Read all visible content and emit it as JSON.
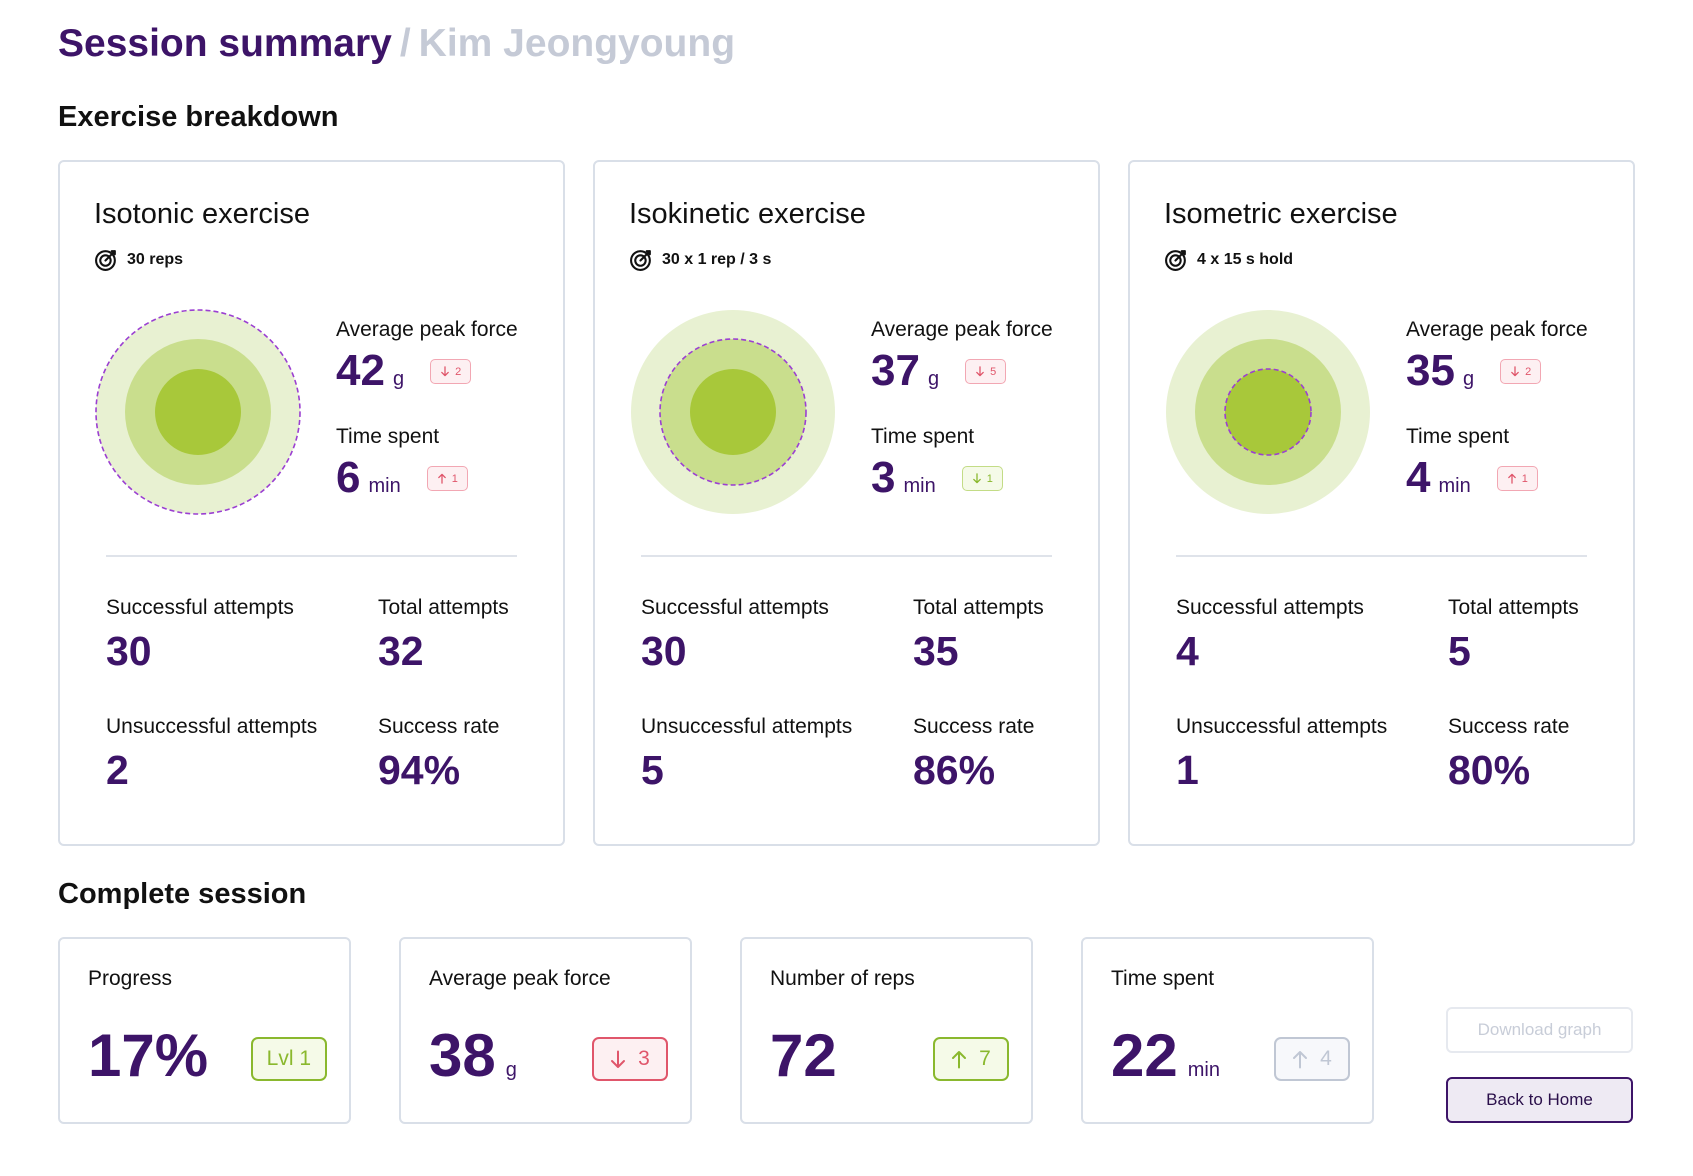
{
  "header": {
    "title": "Session summary",
    "separator": "/",
    "patient": "Kim Jeongyoung"
  },
  "sections": {
    "breakdown": "Exercise breakdown",
    "complete": "Complete session"
  },
  "colors": {
    "primary": "#3d1468",
    "ring_outer": "#e8f1d2",
    "ring_middle": "#c9de8d",
    "ring_inner": "#a8c83a",
    "target_dash": "#9b3fd2",
    "down": "#e0566b",
    "up_green": "#8ab82e",
    "muted": "#c0c7d4"
  },
  "exercises": [
    {
      "title": "Isotonic exercise",
      "target_icon": "target-icon",
      "target": "30 reps",
      "rings": {
        "target_level": "outer"
      },
      "force_label": "Average peak force",
      "force_value": "42",
      "force_unit": "g",
      "force_delta": {
        "direction": "down",
        "value": "2",
        "tone": "red"
      },
      "time_label": "Time spent",
      "time_value": "6",
      "time_unit": "min",
      "time_delta": {
        "direction": "up",
        "value": "1",
        "tone": "red"
      },
      "successful_label": "Successful attempts",
      "successful": "30",
      "total_label": "Total attempts",
      "total": "32",
      "unsuccessful_label": "Unsuccessful attempts",
      "unsuccessful": "2",
      "rate_label": "Success rate",
      "rate": "94%"
    },
    {
      "title": "Isokinetic exercise",
      "target_icon": "target-icon",
      "target": "30 x 1 rep / 3 s",
      "rings": {
        "target_level": "middle"
      },
      "force_label": "Average peak force",
      "force_value": "37",
      "force_unit": "g",
      "force_delta": {
        "direction": "down",
        "value": "5",
        "tone": "red"
      },
      "time_label": "Time spent",
      "time_value": "3",
      "time_unit": "min",
      "time_delta": {
        "direction": "down",
        "value": "1",
        "tone": "green"
      },
      "successful_label": "Successful attempts",
      "successful": "30",
      "total_label": "Total attempts",
      "total": "35",
      "unsuccessful_label": "Unsuccessful attempts",
      "unsuccessful": "5",
      "rate_label": "Success rate",
      "rate": "86%"
    },
    {
      "title": "Isometric exercise",
      "target_icon": "target-icon",
      "target": "4 x 15 s hold",
      "rings": {
        "target_level": "inner"
      },
      "force_label": "Average peak force",
      "force_value": "35",
      "force_unit": "g",
      "force_delta": {
        "direction": "down",
        "value": "2",
        "tone": "red"
      },
      "time_label": "Time spent",
      "time_value": "4",
      "time_unit": "min",
      "time_delta": {
        "direction": "up",
        "value": "1",
        "tone": "red"
      },
      "successful_label": "Successful attempts",
      "successful": "4",
      "total_label": "Total attempts",
      "total": "5",
      "unsuccessful_label": "Unsuccessful attempts",
      "unsuccessful": "1",
      "rate_label": "Success rate",
      "rate": "80%"
    }
  ],
  "summary": [
    {
      "label": "Progress",
      "value": "17%",
      "unit": "",
      "badge": {
        "text": "Lvl 1",
        "direction": "none",
        "tone": "green"
      }
    },
    {
      "label": "Average peak force",
      "value": "38",
      "unit": "g",
      "badge": {
        "text": "3",
        "direction": "down",
        "tone": "red"
      }
    },
    {
      "label": "Number of reps",
      "value": "72",
      "unit": "",
      "badge": {
        "text": "7",
        "direction": "up",
        "tone": "green"
      }
    },
    {
      "label": "Time spent",
      "value": "22",
      "unit": "min",
      "badge": {
        "text": "4",
        "direction": "up",
        "tone": "grey"
      }
    }
  ],
  "buttons": {
    "download": "Download graph",
    "home": "Back to Home"
  }
}
